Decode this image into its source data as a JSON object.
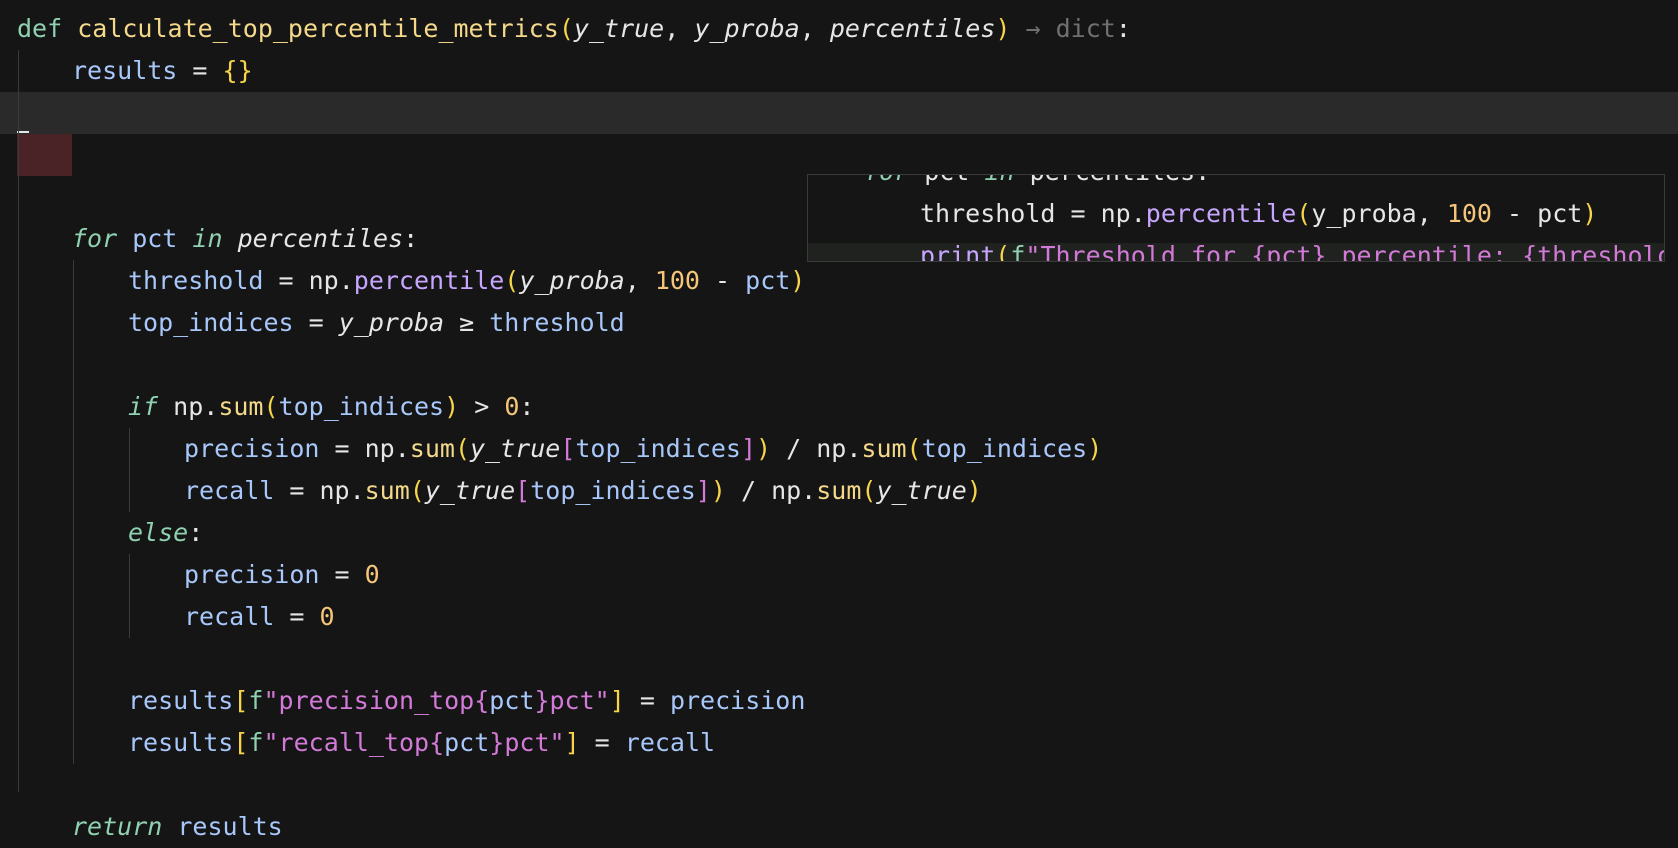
{
  "editor": {
    "language": "python",
    "colors": {
      "background": "#151515",
      "current_line": "#2a2a2a",
      "keyword": "#8fd1b0",
      "function": "#f5d98b",
      "variable": "#a8c7fa",
      "number": "#f5c57a",
      "method": "#c7a6ff",
      "bracket_paren": "#f7d44a",
      "bracket_square": "#d37ad8",
      "error_highlight": "#4a2326"
    },
    "l1": {
      "def": "def",
      "name": "calculate_top_percentile_metrics",
      "open": "(",
      "p1": "y_true",
      "c1": ", ",
      "p2": "y_proba",
      "c2": ", ",
      "p3": "percentiles",
      "close": ")",
      "arrow": " → ",
      "ret": "dict",
      "colon": ":"
    },
    "l2": {
      "var": "results",
      "eq": " = ",
      "val": "{}"
    },
    "l5": {
      "for": "for",
      "v": " pct ",
      "in": "in",
      "iter": " percentiles",
      "colon": ":"
    },
    "l6": {
      "var": "threshold",
      "eq": " = ",
      "np": "np.",
      "fn": "percentile",
      "open": "(",
      "arg": "y_proba",
      "comma": ", ",
      "num": "100",
      "minus": " - ",
      "pct": "pct",
      "close": ")"
    },
    "l7": {
      "var": "top_indices",
      "eq": " = ",
      "lhs": "y_proba",
      "op": " ≥ ",
      "rhs": "threshold"
    },
    "l9": {
      "if": "if",
      "np": " np.",
      "fn": "sum",
      "open": "(",
      "arg": "top_indices",
      "close": ")",
      "gt": " > ",
      "num": "0",
      "colon": ":"
    },
    "l10": {
      "var": "precision",
      "eq": " = ",
      "np1": "np.",
      "fn1": "sum",
      "o1": "(",
      "a1": "y_true",
      "sb1": "[",
      "idx": "top_indices",
      "sb2": "]",
      "c1": ")",
      "div": " / ",
      "np2": "np.",
      "fn2": "sum",
      "o2": "(",
      "a2": "top_indices",
      "c2": ")"
    },
    "l11": {
      "var": "recall",
      "eq": " = ",
      "np1": "np.",
      "fn1": "sum",
      "o1": "(",
      "a1": "y_true",
      "sb1": "[",
      "idx": "top_indices",
      "sb2": "]",
      "c1": ")",
      "div": " / ",
      "np2": "np.",
      "fn2": "sum",
      "o2": "(",
      "a2": "y_true",
      "c2": ")"
    },
    "l12": {
      "else": "else",
      "colon": ":"
    },
    "l13": {
      "var": "precision",
      "eq": " = ",
      "num": "0"
    },
    "l14": {
      "var": "recall",
      "eq": " = ",
      "num": "0"
    },
    "l16": {
      "var": "results",
      "sb1": "[",
      "f": "f",
      "q1": "\"",
      "s1": "precision_top",
      "b1": "{",
      "pv": "pct",
      "b2": "}",
      "s2": "pct",
      "q2": "\"",
      "sb2": "]",
      "eq": " = ",
      "rhs": "precision"
    },
    "l17": {
      "var": "results",
      "sb1": "[",
      "f": "f",
      "q1": "\"",
      "s1": "recall_top",
      "b1": "{",
      "pv": "pct",
      "b2": "}",
      "s2": "pct",
      "q2": "\"",
      "sb2": "]",
      "eq": " = ",
      "rhs": "recall"
    },
    "l19": {
      "ret": "return",
      "val": " results"
    }
  },
  "peek": {
    "p1": {
      "for": "for",
      "v": " pct ",
      "in": "in",
      "iter": " percentiles:"
    },
    "p2": {
      "var": "threshold",
      "eq": " = ",
      "np": "np.",
      "fn": "percentile",
      "open": "(",
      "arg": "y_proba",
      "comma": ", ",
      "num": "100",
      "minus": " - ",
      "pct": "pct",
      "close": ")"
    },
    "p3": {
      "fn": "print",
      "open": "(",
      "f": "f",
      "text": "\"Threshold for {pct} percentile: {threshold}\")"
    }
  }
}
